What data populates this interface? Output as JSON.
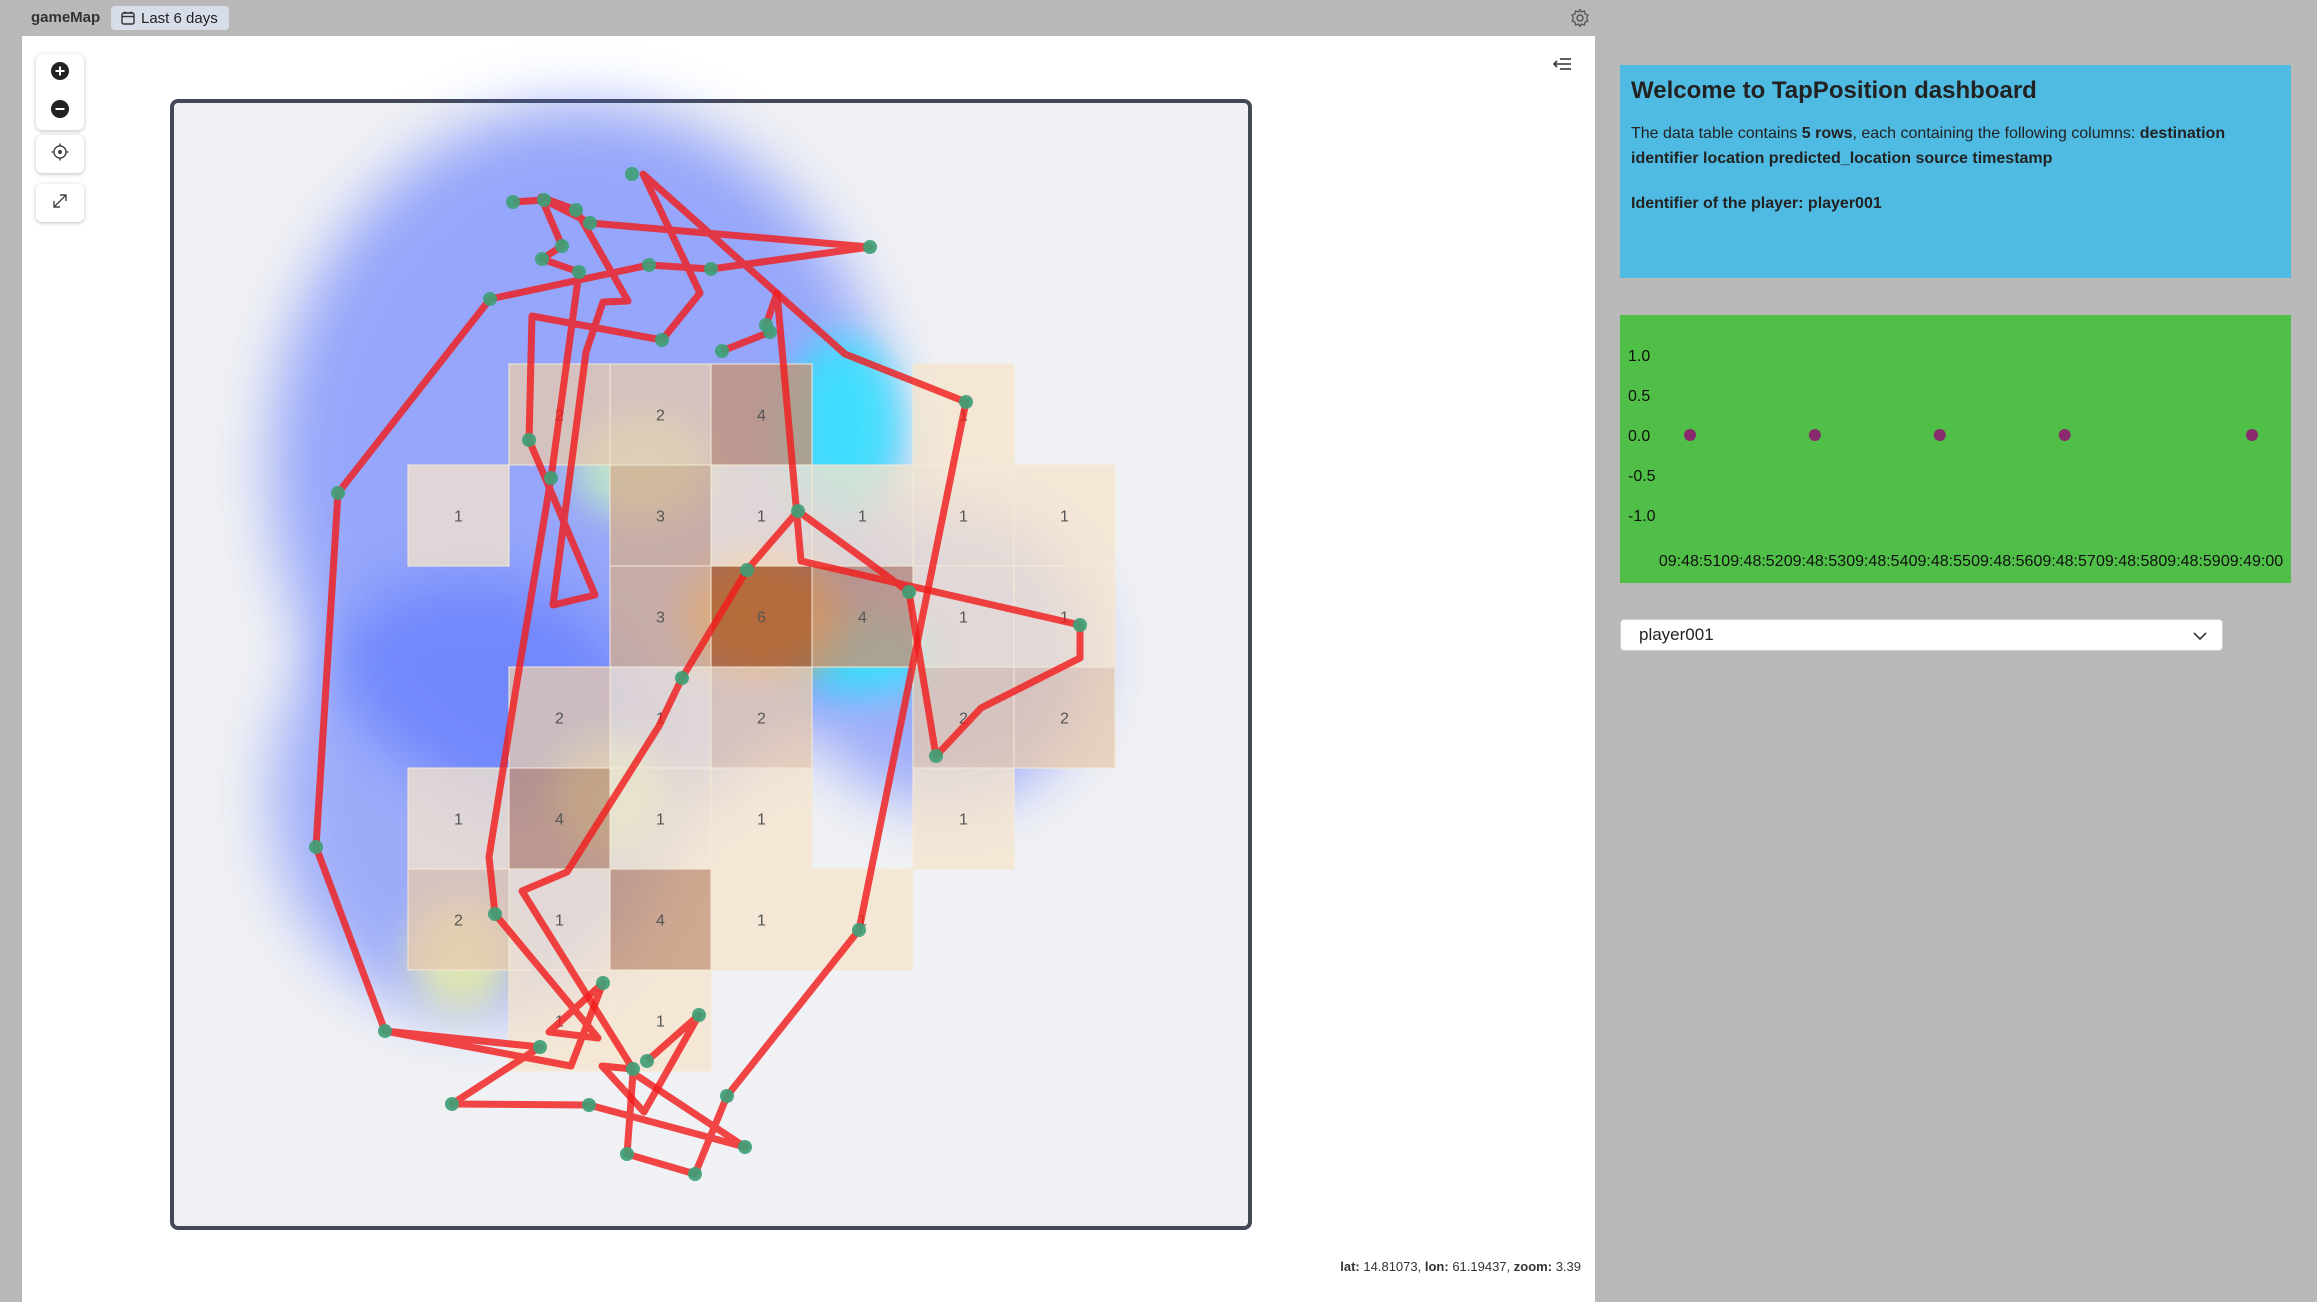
{
  "header": {
    "app_title": "gameMap",
    "time_range": "Last 6 days",
    "calendar_icon": "calendar-icon",
    "settings_icon": "gear-icon"
  },
  "map": {
    "controls": [
      "zoom-in-icon",
      "zoom-out-icon",
      "locate-icon",
      "fullscreen-icon"
    ],
    "sidebar_toggle_icon": "collapse-sidebar-icon",
    "status": {
      "lat_label": "lat:",
      "lat": "14.81073,",
      "lon_label": "lon:",
      "lon": "61.19437,",
      "zoom_label": "zoom:",
      "zoom": "3.39"
    },
    "grid_counts": [
      [
        "",
        "2",
        "2",
        "4",
        "",
        "1",
        ""
      ],
      [
        "1",
        "",
        "3",
        "1",
        "1",
        "1",
        "1"
      ],
      [
        "",
        "",
        "3",
        "6",
        "4",
        "1",
        "1"
      ],
      [
        "",
        "2",
        "1",
        "2",
        "",
        "2",
        "2"
      ],
      [
        "1",
        "4",
        "1",
        "1",
        "",
        "1",
        ""
      ],
      [
        "2",
        "1",
        "4",
        "1",
        "1",
        "",
        ""
      ],
      [
        "",
        "1",
        "1",
        "",
        "",
        "",
        ""
      ]
    ],
    "colors": {
      "path": "#f01d1d",
      "node": "#3f9f77",
      "frame": "#434955",
      "plot_bg": "#f0f1f4"
    }
  },
  "welcome": {
    "title": "Welcome to TapPosition dashboard",
    "line_prefix": "The data table contains ",
    "row_count": "5 rows",
    "line_mid": ", each containing the following columns: ",
    "columns": "destination identifier location predicted_location source timestamp",
    "player_line": "Identifier of the player: player001"
  },
  "chart_data": {
    "type": "scatter",
    "x": [
      "09:48:51",
      "09:48:53",
      "09:48:55",
      "09:48:57",
      "09:49:00"
    ],
    "y": [
      0.0,
      0.0,
      0.0,
      0.0,
      0.0
    ],
    "x_ticks": [
      "09:48:51",
      "09:48:52",
      "09:48:53",
      "09:48:54",
      "09:48:55",
      "09:48:56",
      "09:48:57",
      "09:48:58",
      "09:48:59",
      "09:49:00"
    ],
    "y_ticks": [
      "1.0",
      "0.5",
      "0.0",
      "-0.5",
      "-1.0"
    ],
    "ylim": [
      -1.0,
      1.0
    ],
    "grid": false,
    "point_color": "#8a2a6e",
    "background": "#4fbf47"
  },
  "player_select": {
    "selected": "player001",
    "icon": "chevron-down-icon"
  }
}
